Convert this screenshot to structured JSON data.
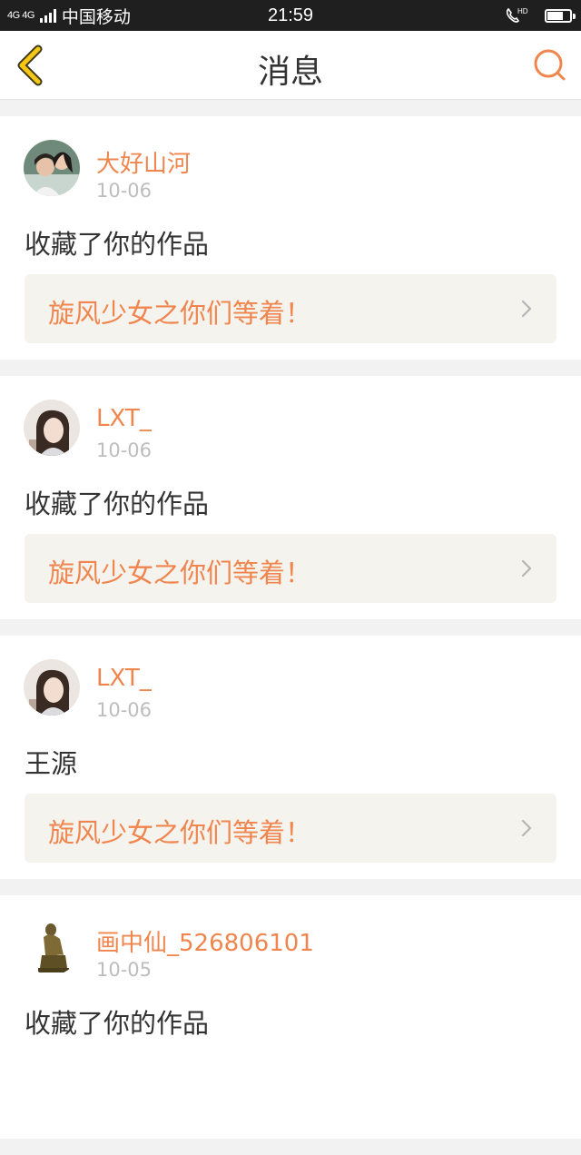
{
  "status_bar": {
    "network": "4G 4G",
    "carrier": "中国移动",
    "time": "21:59",
    "hd_label": "HD"
  },
  "header": {
    "back_icon": "back-chevron-icon",
    "title": "消息",
    "search_icon": "search-icon"
  },
  "messages": [
    {
      "user": "大好山河",
      "date": "10-06",
      "action": "收藏了你的作品",
      "work": "旋风少女之你们等着！",
      "avatar": "photo-avatar-couple"
    },
    {
      "user": "LXT_",
      "date": "10-06",
      "action": "收藏了你的作品",
      "work": "旋风少女之你们等着！",
      "avatar": "photo-avatar-girl"
    },
    {
      "user": "LXT_",
      "date": "10-06",
      "action": "王源",
      "work": "旋风少女之你们等着！",
      "avatar": "photo-avatar-girl"
    },
    {
      "user": "画中仙_526806101",
      "date": "10-05",
      "action": "收藏了你的作品",
      "avatar": "statue-avatar"
    }
  ],
  "colors": {
    "accent": "#f0854e",
    "back_icon": "#f5c518",
    "work_bg": "#f4f3ee",
    "date": "#bdbdbd"
  }
}
